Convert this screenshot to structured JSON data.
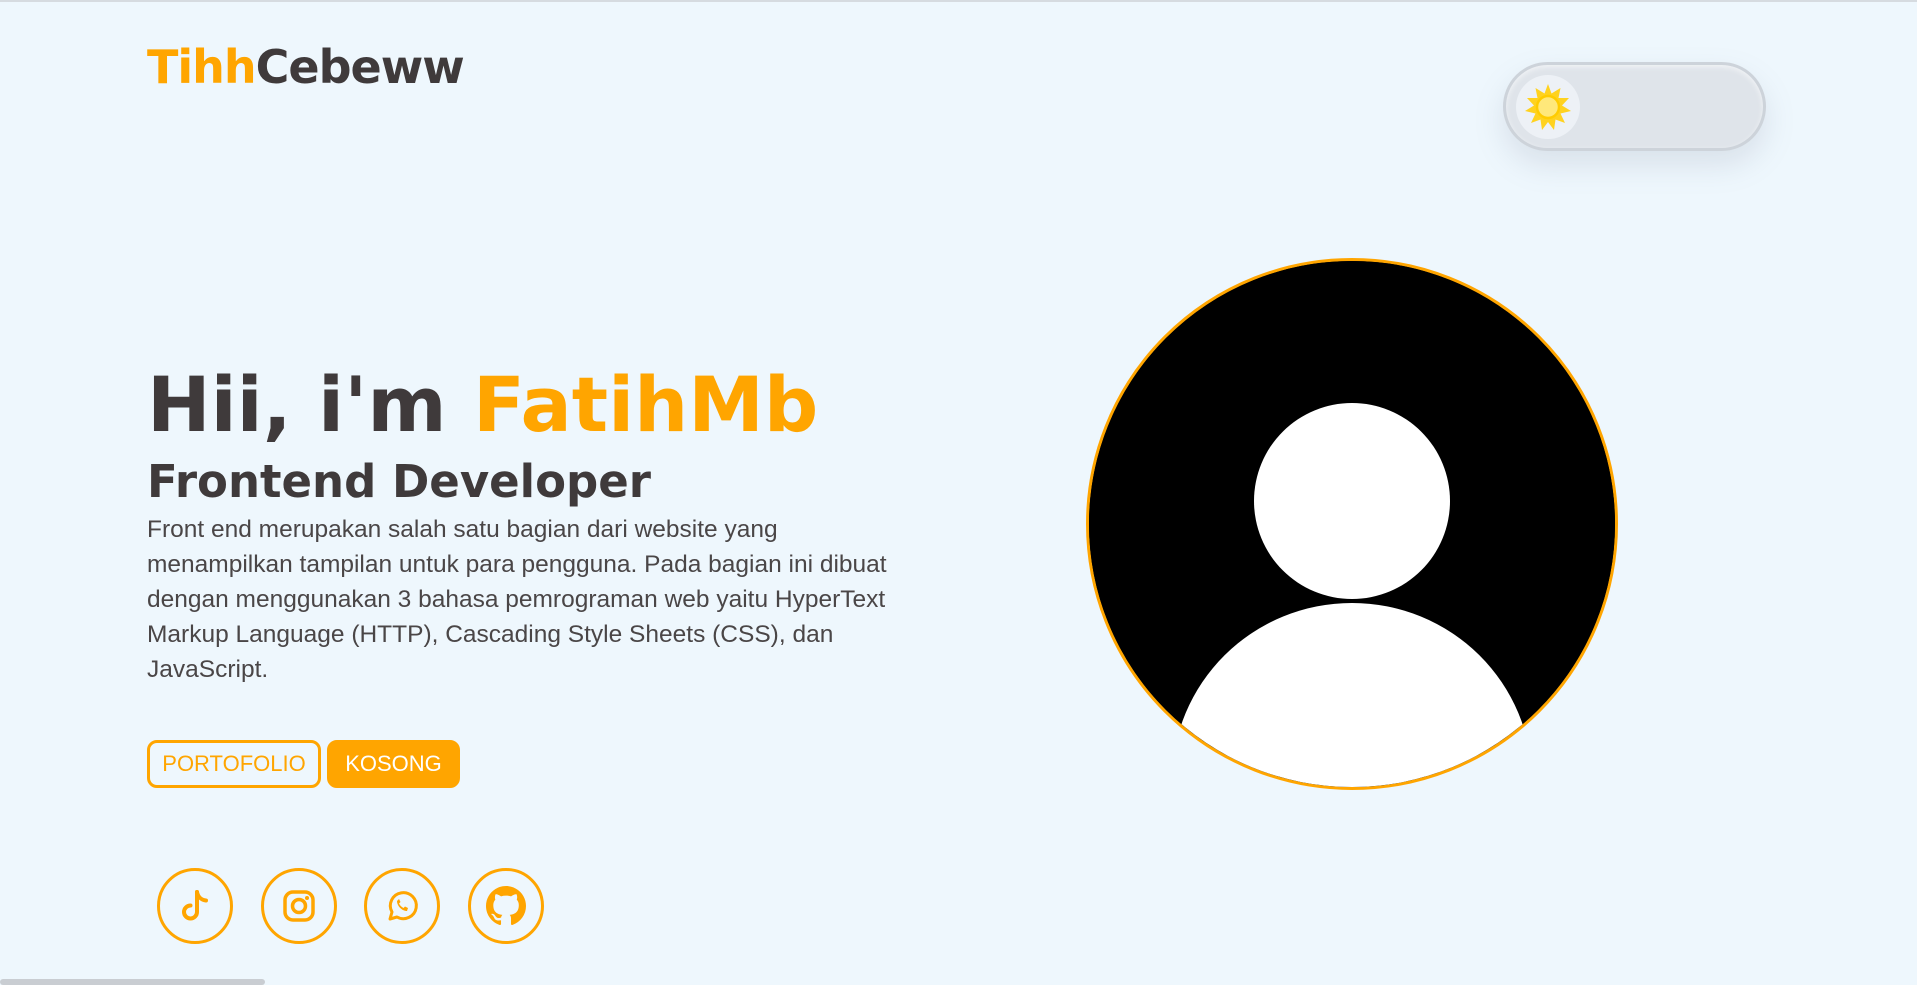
{
  "logo": {
    "accent": "Tihh",
    "rest": "Cebeww"
  },
  "theme_toggle": {
    "icon": "sun-icon",
    "state": "light"
  },
  "hero": {
    "greeting": "Hii, i'm",
    "name": "FatihMb",
    "role": "Frontend Developer",
    "description": "Front end merupakan salah satu bagian dari website yang menampilkan tampilan untuk para pengguna. Pada bagian ini dibuat dengan menggunakan 3 bahasa pemrograman web yaitu HyperText Markup Language (HTTP), Cascading Style Sheets (CSS), dan JavaScript."
  },
  "buttons": {
    "portfolio": "PORTOFOLIO",
    "empty": "KOSONG"
  },
  "social": [
    "tiktok-icon",
    "instagram-icon",
    "whatsapp-icon",
    "github-icon"
  ],
  "colors": {
    "accent": "#ffa500",
    "text": "#3f3a3b",
    "background": "#eef7fd"
  }
}
